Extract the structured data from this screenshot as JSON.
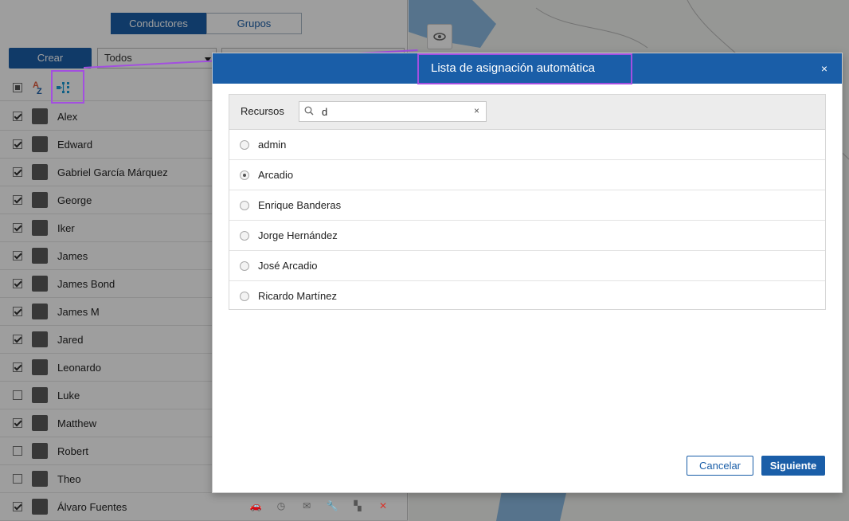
{
  "left_panel": {
    "tabs": [
      {
        "label": "Conductores",
        "active": true
      },
      {
        "label": "Grupos",
        "active": false
      }
    ],
    "create_button": "Crear",
    "filter_select": "Todos",
    "drivers": [
      {
        "name": "Alex",
        "checked": true
      },
      {
        "name": "Edward",
        "checked": true
      },
      {
        "name": "Gabriel García Márquez",
        "checked": true
      },
      {
        "name": "George",
        "checked": true
      },
      {
        "name": "Iker",
        "checked": true
      },
      {
        "name": "James",
        "checked": true
      },
      {
        "name": "James Bond",
        "checked": true
      },
      {
        "name": "James M",
        "checked": true
      },
      {
        "name": "Jared",
        "checked": true
      },
      {
        "name": "Leonardo",
        "checked": true
      },
      {
        "name": "Luke",
        "checked": false
      },
      {
        "name": "Matthew",
        "checked": true
      },
      {
        "name": "Robert",
        "checked": false
      },
      {
        "name": "Theo",
        "checked": false
      },
      {
        "name": "Álvaro Fuentes",
        "checked": true
      }
    ]
  },
  "dialog": {
    "title": "Lista de asignación automática",
    "close": "×",
    "resources_label": "Recursos",
    "search_value": "d",
    "clear": "×",
    "options": [
      {
        "label": "admin",
        "selected": false
      },
      {
        "label": "Arcadio",
        "selected": true
      },
      {
        "label": "Enrique Banderas",
        "selected": false
      },
      {
        "label": "Jorge Hernández",
        "selected": false
      },
      {
        "label": "José Arcadio",
        "selected": false
      },
      {
        "label": "Ricardo Martínez",
        "selected": false
      }
    ],
    "cancel_button": "Cancelar",
    "next_button": "Siguiente"
  },
  "colors": {
    "accent": "#1a5ea8",
    "highlight": "#a34fe0"
  }
}
